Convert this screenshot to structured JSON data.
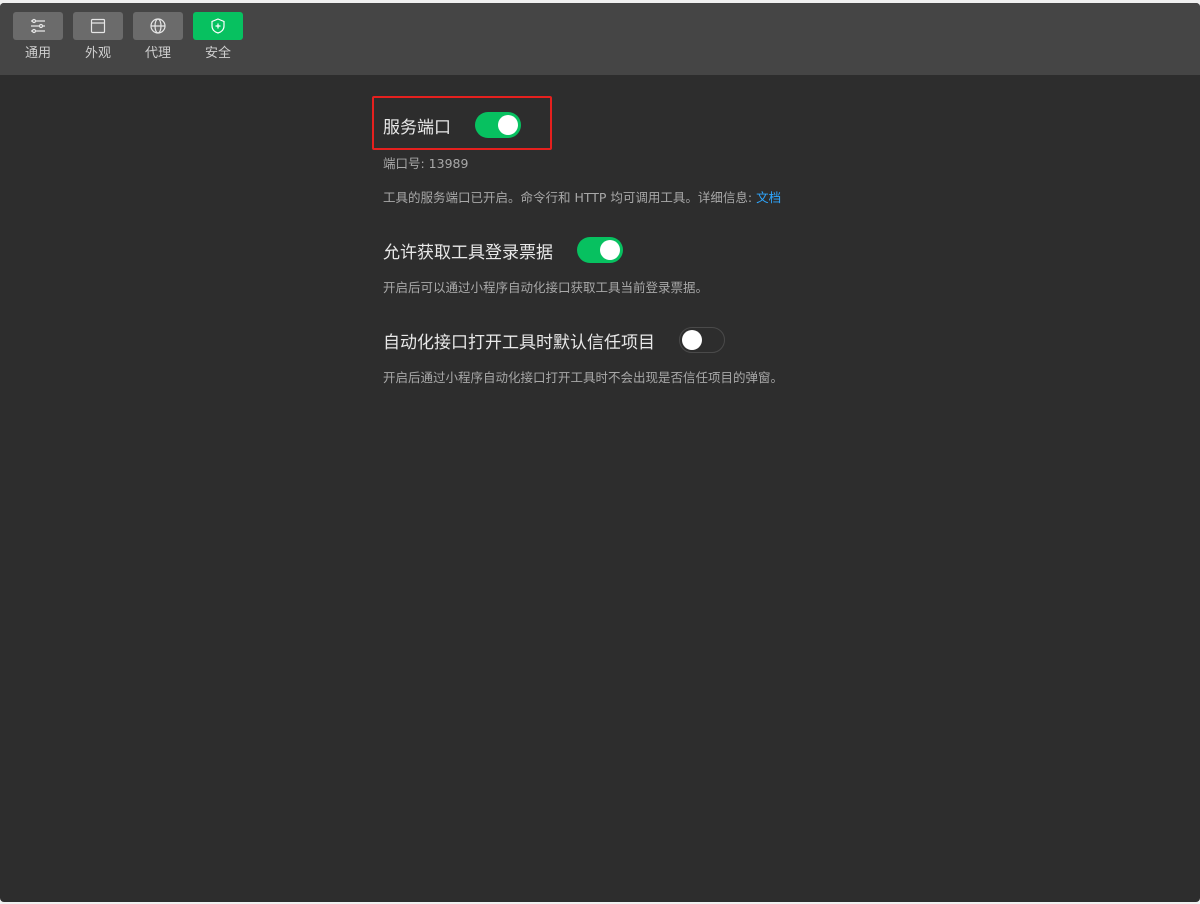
{
  "tabs": [
    {
      "label": "通用",
      "icon": "sliders-icon",
      "active": false
    },
    {
      "label": "外观",
      "icon": "window-icon",
      "active": false
    },
    {
      "label": "代理",
      "icon": "globe-icon",
      "active": false
    },
    {
      "label": "安全",
      "icon": "shield-plus-icon",
      "active": true
    }
  ],
  "settings": {
    "service_port": {
      "title": "服务端口",
      "enabled": true,
      "port_text": "端口号: 13989",
      "desc": "工具的服务端口已开启。命令行和 HTTP 均可调用工具。详细信息: ",
      "link": "文档"
    },
    "ticket": {
      "title": "允许获取工具登录票据",
      "enabled": true,
      "desc": "开启后可以通过小程序自动化接口获取工具当前登录票据。"
    },
    "trust": {
      "title": "自动化接口打开工具时默认信任项目",
      "enabled": false,
      "desc": "开启后通过小程序自动化接口打开工具时不会出现是否信任项目的弹窗。"
    }
  },
  "colors": {
    "accent": "#07c160",
    "highlight": "#e5201e",
    "link": "#2ea7ff"
  }
}
